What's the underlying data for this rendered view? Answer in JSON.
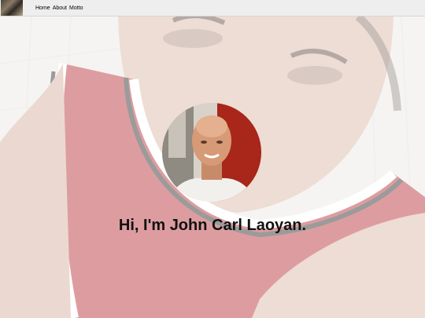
{
  "nav": {
    "items": [
      "Home",
      "About",
      "Motto"
    ]
  },
  "hero": {
    "headline": "Hi, I'm John Carl Laoyan."
  },
  "colors": {
    "jersey_red": "#b3262d",
    "nav_bg": "#eeeeee",
    "headline": "#111111"
  },
  "icons": {
    "nav_thumb": "site-logo-photo",
    "avatar": "profile-photo"
  }
}
